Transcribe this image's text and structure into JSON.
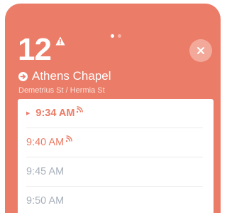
{
  "header": {
    "route_number": "12",
    "stop_name": "Athens Chapel",
    "cross_street": "Demetrius St / Hermia St",
    "page_count": 2,
    "active_page": 1
  },
  "times": [
    {
      "label": "9:34 AM",
      "realtime": true,
      "selected": true
    },
    {
      "label": "9:40 AM",
      "realtime": true,
      "selected": false
    },
    {
      "label": "9:45 AM",
      "realtime": false,
      "selected": false
    },
    {
      "label": "9:50 AM",
      "realtime": false,
      "selected": false
    }
  ],
  "colors": {
    "accent": "#eb7c67",
    "scheduled_text": "#a9b0bb",
    "background": "#ffffff"
  },
  "icons": {
    "alert": "warning-triangle-icon",
    "direction": "arrow-circle-right-icon",
    "close": "close-icon",
    "realtime": "realtime-signal-icon",
    "selected": "caret-right-icon"
  }
}
